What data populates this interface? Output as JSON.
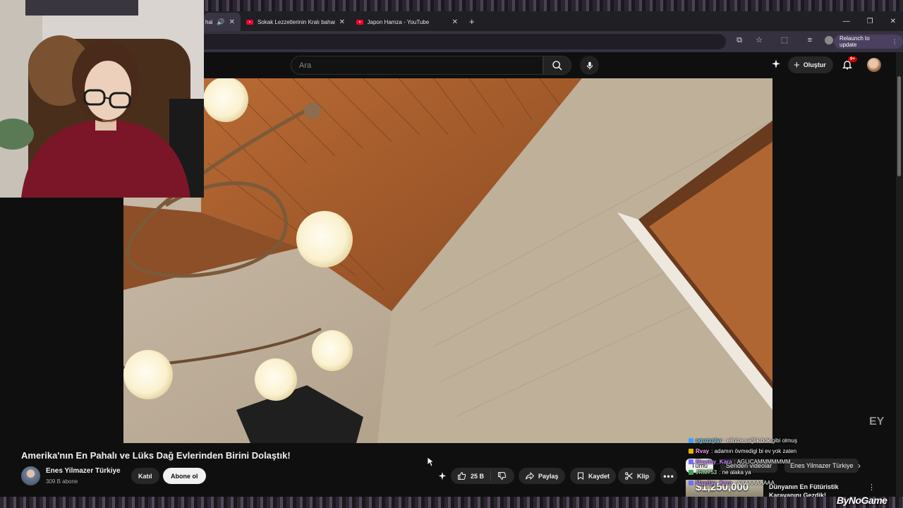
{
  "browser": {
    "tabs": [
      {
        "title": "hali",
        "active": true
      },
      {
        "title": "Sokak Lezzetlerinin Kralı bahar",
        "active": false
      },
      {
        "title": "Japon Hamza - YouTube",
        "active": false
      }
    ],
    "new_tab": "+",
    "relaunch_label": "Relaunch to update"
  },
  "youtube": {
    "search_placeholder": "Ara",
    "create_label": "Oluştur",
    "notification_badge": "9+"
  },
  "video": {
    "title": "Amerika'nın En Pahalı ve Lüks Dağ Evlerinden Birini Dolaştık!",
    "channel_name": "Enes Yilmazer Türkiye",
    "subscribers": "309 B abone",
    "join_label": "Katıl",
    "subscribe_label": "Abone ol",
    "like_count": "25 B",
    "share_label": "Paylaş",
    "save_label": "Kaydet",
    "clip_label": "Klip",
    "watermark": "EY"
  },
  "chips": [
    "Tümü",
    "Senden videolar",
    "Enes Yilmazer Türkiye"
  ],
  "related": {
    "thumb_text": "$1,250,000",
    "title": "Dünyanın En Fütüristik Karavanını Gezdik!"
  },
  "chat": [
    {
      "user": "oguzzglvr",
      "message": ": elinize sağlık bok gibi olmuş",
      "color": "#7fd3ff"
    },
    {
      "user": "Rvay",
      "message": ": adamın övmedigi bi ev yok zaten",
      "color": "#ff9de2"
    },
    {
      "user": "Mayday_Kara",
      "message": ": AGLICAMMMMMMM",
      "color": "#c98cff"
    },
    {
      "user": "JRM753",
      "message": ": ne alaka ya",
      "color": "#8fd18f"
    },
    {
      "user": "Mayday_Kara",
      "message": ": AAAAAAAAAA",
      "color": "#c98cff"
    }
  ],
  "sponsor": "ByNoGame",
  "colors": {
    "youtube_red": "#ff0033",
    "background": "#0f0f0f",
    "button_bg": "#272727"
  }
}
